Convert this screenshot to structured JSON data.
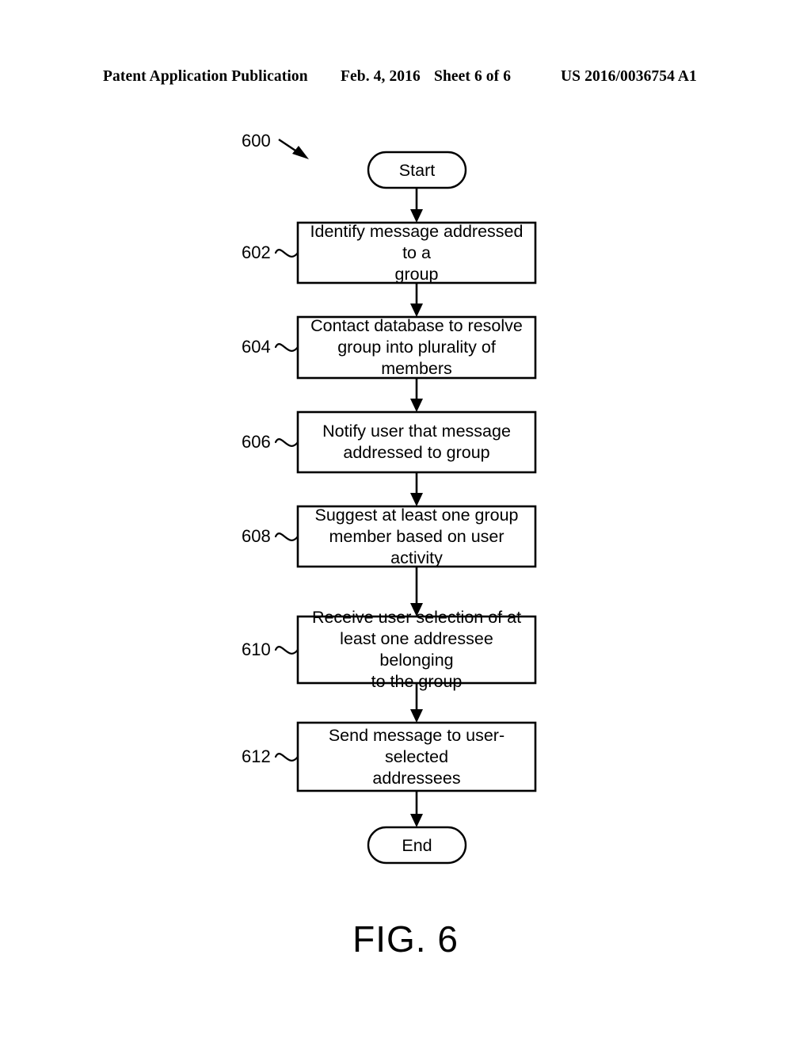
{
  "header": {
    "publication": "Patent Application Publication",
    "date": "Feb. 4, 2016",
    "sheet": "Sheet 6 of 6",
    "number": "US 2016/0036754 A1"
  },
  "figure": {
    "caption": "FIG. 6",
    "diagram_label": "600"
  },
  "flowchart": {
    "start_label": "Start",
    "end_label": "End",
    "steps": [
      {
        "ref": "602",
        "text": "Identify message addressed to a\ngroup"
      },
      {
        "ref": "604",
        "text": "Contact database to resolve\ngroup into plurality of members"
      },
      {
        "ref": "606",
        "text": "Notify user that message\naddressed to group"
      },
      {
        "ref": "608",
        "text": "Suggest at least one group\nmember based on user activity"
      },
      {
        "ref": "610",
        "text": "Receive user selection of at\nleast one addressee belonging\nto the group"
      },
      {
        "ref": "612",
        "text": "Send message to user-selected\naddressees"
      }
    ]
  },
  "colors": {
    "ink": "#000000",
    "paper": "#ffffff"
  }
}
